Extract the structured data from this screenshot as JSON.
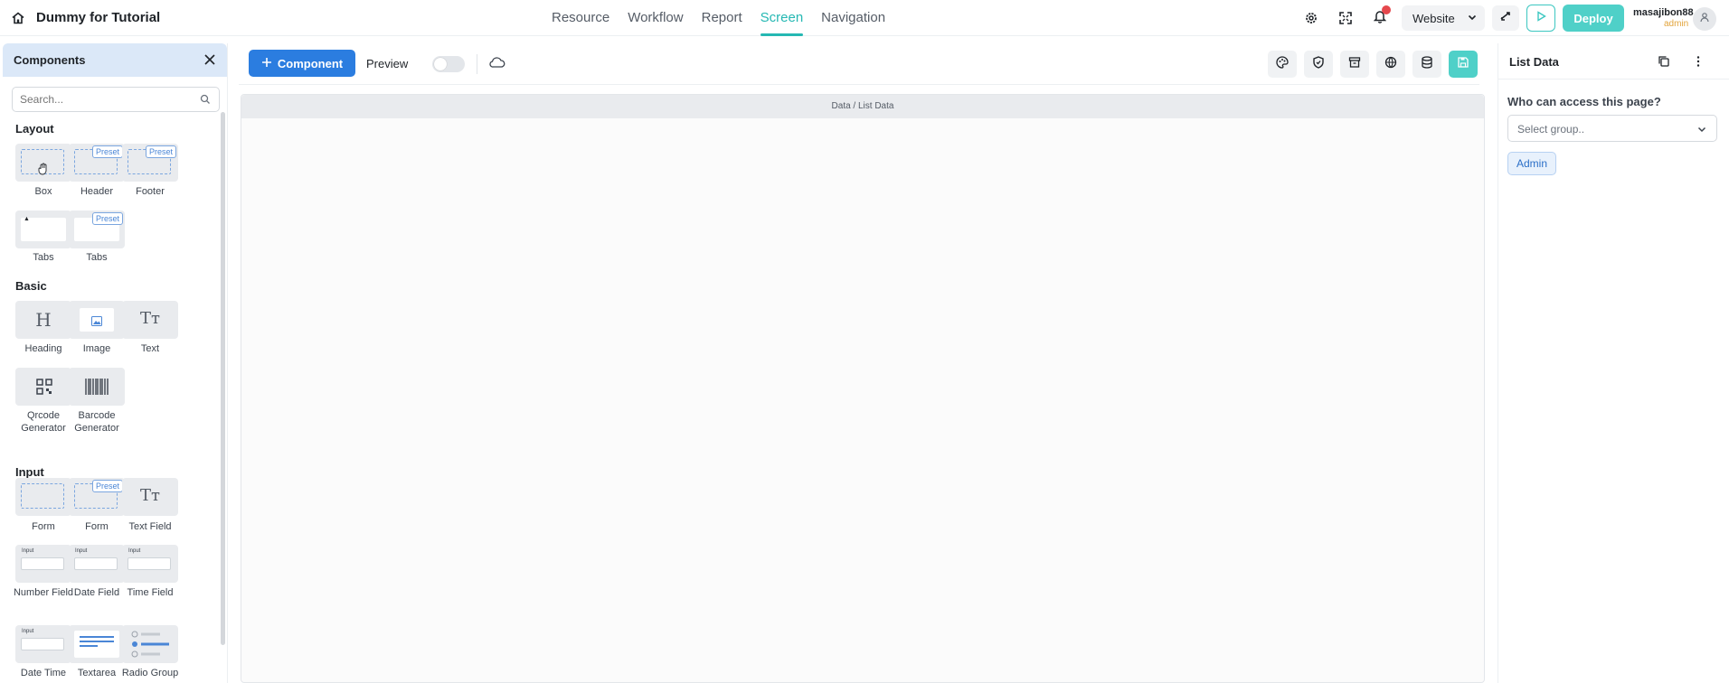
{
  "app": {
    "title": "Dummy for Tutorial"
  },
  "nav": {
    "items": [
      {
        "label": "Resource"
      },
      {
        "label": "Workflow"
      },
      {
        "label": "Report"
      },
      {
        "label": "Screen",
        "active": true
      },
      {
        "label": "Navigation"
      }
    ]
  },
  "topbar": {
    "website_select": "Website",
    "deploy_label": "Deploy",
    "user_name": "masajibon88",
    "user_role": "admin",
    "notification_dot_color": "#e5484d"
  },
  "components_panel": {
    "title": "Components",
    "search_placeholder": "Search...",
    "sections": [
      {
        "title": "Layout",
        "items": [
          "Box",
          "Header",
          "Footer",
          "Tabs",
          "Tabs"
        ]
      },
      {
        "title": "Basic",
        "items": [
          "Heading",
          "Image",
          "Text",
          "Qrcode Generator",
          "Barcode Generator"
        ]
      },
      {
        "title": "Input",
        "items": [
          "Form",
          "Form",
          "Text Field",
          "Number Field",
          "Date Field",
          "Time Field",
          "Date Time",
          "Textarea",
          "Radio Group"
        ]
      }
    ],
    "preset_label": "Preset",
    "input_label": "Input"
  },
  "canvas_toolbar": {
    "component_button": "Component",
    "preview_label": "Preview",
    "preview_enabled": false
  },
  "canvas": {
    "breadcrumb": "Data / List Data"
  },
  "right_panel": {
    "title": "List Data",
    "access_label": "Who can access this page?",
    "select_placeholder": "Select group..",
    "groups": [
      "Admin"
    ]
  },
  "colors": {
    "accent": "#25b8b3",
    "primary_blue": "#2b7de0",
    "deploy": "#4fd0c8",
    "panel_header": "#dbe8f8"
  }
}
